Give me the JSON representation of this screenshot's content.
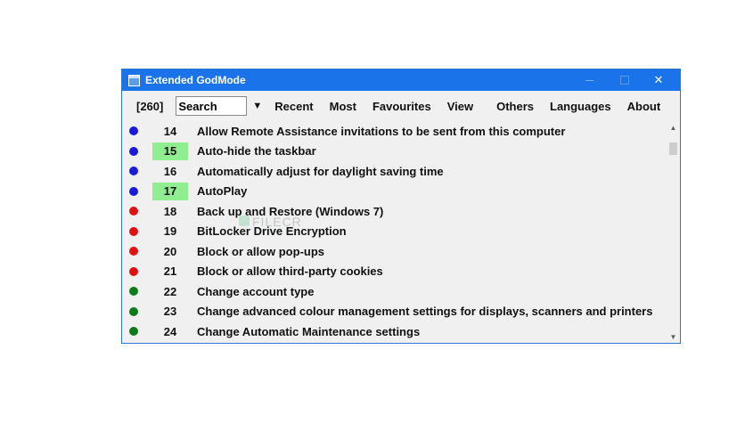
{
  "window": {
    "title": "Extended GodMode",
    "minimize_icon": "minimize-icon",
    "maximize_icon": "maximize-icon",
    "close_glyph": "✕"
  },
  "toolbar": {
    "count": "[260]",
    "search_value": "Search",
    "dropdown_glyph": "▼",
    "menu": [
      "Recent",
      "Most",
      "Favourites",
      "View",
      "Others",
      "Languages",
      "About"
    ]
  },
  "colors": {
    "blue": "#1a1adc",
    "red": "#e01010",
    "green": "#0a7a1a",
    "highlight": "#90ee90",
    "titlebar": "#1a73e8"
  },
  "list": [
    {
      "num": "14",
      "label": "Allow Remote Assistance invitations to be sent from this computer",
      "dot": "blue",
      "highlight": false
    },
    {
      "num": "15",
      "label": "Auto-hide the taskbar",
      "dot": "blue",
      "highlight": true
    },
    {
      "num": "16",
      "label": "Automatically adjust for daylight saving time",
      "dot": "blue",
      "highlight": false
    },
    {
      "num": "17",
      "label": "AutoPlay",
      "dot": "blue",
      "highlight": true
    },
    {
      "num": "18",
      "label": "Back up and Restore (Windows 7)",
      "dot": "red",
      "highlight": false
    },
    {
      "num": "19",
      "label": "BitLocker Drive Encryption",
      "dot": "red",
      "highlight": false
    },
    {
      "num": "20",
      "label": "Block or allow pop-ups",
      "dot": "red",
      "highlight": false
    },
    {
      "num": "21",
      "label": "Block or allow third-party cookies",
      "dot": "red",
      "highlight": false
    },
    {
      "num": "22",
      "label": "Change account type",
      "dot": "green",
      "highlight": false
    },
    {
      "num": "23",
      "label": "Change advanced colour management settings for displays, scanners and printers",
      "dot": "green",
      "highlight": false
    },
    {
      "num": "24",
      "label": "Change Automatic Maintenance settings",
      "dot": "green",
      "highlight": false
    }
  ],
  "scrollbar": {
    "up_glyph": "▲",
    "down_glyph": "▼"
  },
  "watermark": "FILECR"
}
